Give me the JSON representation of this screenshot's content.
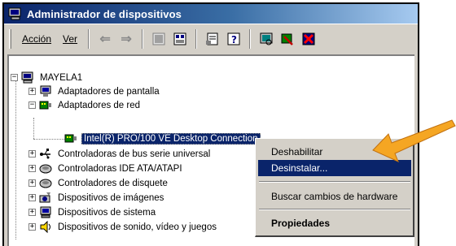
{
  "window": {
    "title": "Administrador de dispositivos"
  },
  "menu": {
    "accion": "Acción",
    "ver": "Ver"
  },
  "toolbar": {
    "icons": [
      "back-arrow-icon",
      "forward-arrow-icon",
      "device-view-icon",
      "properties-icon",
      "help-icon",
      "scan-hardware-icon",
      "disable-icon",
      "uninstall-icon"
    ]
  },
  "tree": {
    "root": "MAYELA1",
    "items": [
      {
        "label": "Adaptadores de pantalla",
        "icon": "monitor-icon",
        "expander": "+"
      },
      {
        "label": "Adaptadores de red",
        "icon": "network-card-icon",
        "expander": "−"
      },
      {
        "label": "Intel(R) PRO/100 VE Desktop Connection",
        "icon": "network-card-icon",
        "expander": ""
      },
      {
        "label": "Controladoras de bus serie universal",
        "icon": "usb-icon",
        "expander": "+"
      },
      {
        "label": "Controladoras IDE ATA/ATAPI",
        "icon": "ide-controller-icon",
        "expander": "+"
      },
      {
        "label": "Controladores de disquete",
        "icon": "floppy-controller-icon",
        "expander": "+"
      },
      {
        "label": "Dispositivos de imágenes",
        "icon": "camera-icon",
        "expander": "+"
      },
      {
        "label": "Dispositivos de sistema",
        "icon": "system-device-icon",
        "expander": "+"
      },
      {
        "label": "Dispositivos de sonido, vídeo y juegos",
        "icon": "sound-icon",
        "expander": "+"
      }
    ]
  },
  "context_menu": {
    "items": [
      "Deshabilitar",
      "Desinstalar...",
      "Buscar cambios de hardware",
      "Propiedades"
    ]
  },
  "colors": {
    "title_gradient_start": "#0a246a",
    "selection": "#0a246a",
    "callout_arrow": "#f5a623"
  }
}
